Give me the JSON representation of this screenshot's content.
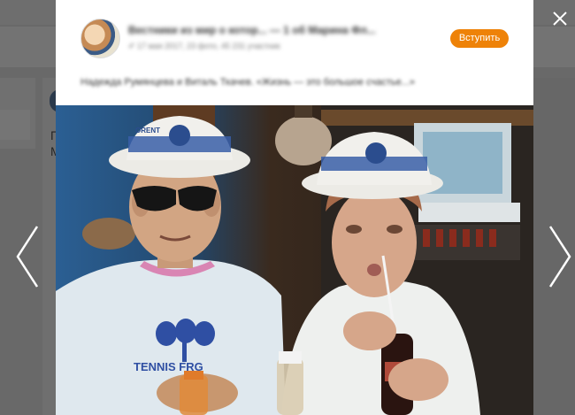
{
  "background_page": {
    "letters": [
      "П",
      "М"
    ]
  },
  "post": {
    "group_title": "Вестники из мир о котор... — 1 об Марина Фл...",
    "group_meta": "✐ 17 мая 2017, 23 фото, 45 231 участник",
    "join_label": "Вступить",
    "caption": "Надежда Румянцева и Виталь Ткачев. «Жизнь — это большое счастье...»"
  },
  "photo": {
    "hat_text_left": "ORENT",
    "shirt_text_left": "TENNIS FRG"
  },
  "icons": {
    "close": "close-icon",
    "prev": "chevron-left-icon",
    "next": "chevron-right-icon"
  },
  "colors": {
    "accent": "#ee8208",
    "overlay": "#282828",
    "modal_bg": "#ffffff"
  }
}
